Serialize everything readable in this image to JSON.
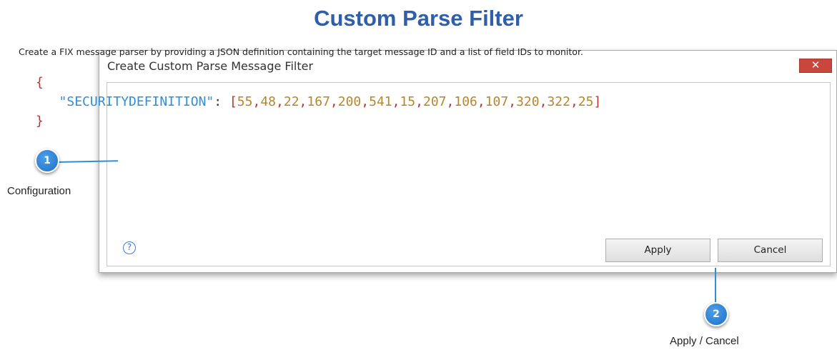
{
  "page": {
    "title": "Custom Parse Filter"
  },
  "dialog": {
    "title": "Create Custom Parse Message Filter",
    "close_label": "✕",
    "description": "Create a FIX message parser by providing a JSON definition containing the target message ID and a list of field IDs to monitor.",
    "code": {
      "open_brace": "{",
      "key": "\"SECURITYDEFINITION\"",
      "colon": ":",
      "values": [
        "55",
        "48",
        "22",
        "167",
        "200",
        "541",
        "15",
        "207",
        "106",
        "107",
        "320",
        "322",
        "25"
      ],
      "close_brace": "}"
    },
    "help_label": "?",
    "apply_label": "Apply",
    "cancel_label": "Cancel"
  },
  "callouts": [
    {
      "number": "1",
      "label": "Configuration"
    },
    {
      "number": "2",
      "label": "Apply / Cancel"
    }
  ],
  "colors": {
    "title": "#2f5fa8",
    "accent": "#2f8fd6",
    "close": "#c9463d",
    "json_key": "#2f8fd6",
    "json_number": "#b5862f",
    "json_bracket": "#b5362f"
  }
}
